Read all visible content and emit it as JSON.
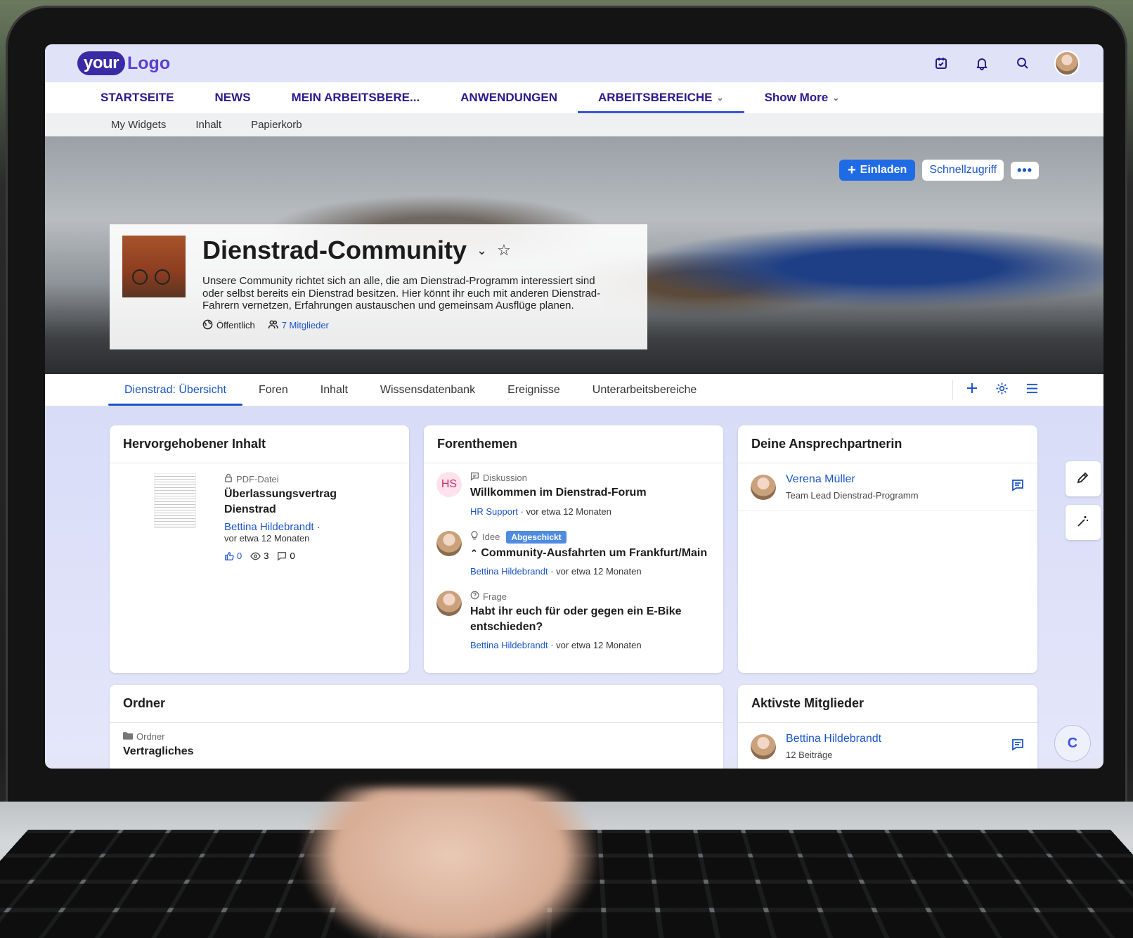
{
  "logo": {
    "part1": "your",
    "part2": "Logo"
  },
  "mainnav": [
    {
      "label": "STARTSEITE"
    },
    {
      "label": "NEWS"
    },
    {
      "label": "MEIN ARBEITSBERE..."
    },
    {
      "label": "ANWENDUNGEN"
    },
    {
      "label": "ARBEITSBEREICHE"
    },
    {
      "label": "Show More"
    }
  ],
  "subnav": [
    "My Widgets",
    "Inhalt",
    "Papierkorb"
  ],
  "hero": {
    "invite": "Einladen",
    "quick": "Schnellzugriff",
    "more": "•••",
    "title": "Dienstrad-Community",
    "description": "Unsere Community richtet sich an alle, die am Dienstrad-Programm interessiert sind oder selbst bereits ein Dienstrad besitzen. Hier könnt ihr euch mit anderen Dienstrad-Fahrern vernetzen, Erfahrungen austauschen und gemeinsam Ausflüge planen.",
    "visibility": "Öffentlich",
    "members": "7 Mitglieder"
  },
  "tabs": [
    "Dienstrad: Übersicht",
    "Foren",
    "Inhalt",
    "Wissensdatenbank",
    "Ereignisse",
    "Unterarbeitsbereiche"
  ],
  "highlight": {
    "header": "Hervorgehobener Inhalt",
    "type": "PDF-Datei",
    "title": "Überlassungsvertrag Dienstrad",
    "author": "Bettina Hildebrandt",
    "author_sep": "·",
    "time": "vor etwa 12 Monaten",
    "likes": "0",
    "views": "3",
    "comments": "0"
  },
  "forum": {
    "header": "Forenthemen",
    "items": [
      {
        "type": "Diskussion",
        "badge": "",
        "title": "Willkommen im Dienstrad-Forum",
        "author": "HR Support",
        "time": "· vor etwa 12 Monaten",
        "initials": "HS"
      },
      {
        "type": "Idee",
        "badge": "Abgeschickt",
        "title": "Community-Ausfahrten um Frankfurt/Main",
        "author": "Bettina Hildebrandt",
        "time": "· vor etwa 12 Monaten",
        "initials": ""
      },
      {
        "type": "Frage",
        "badge": "",
        "title": "Habt ihr euch für oder gegen ein E-Bike entschieden?",
        "author": "Bettina Hildebrandt",
        "time": "· vor etwa 12 Monaten",
        "initials": ""
      }
    ]
  },
  "contact": {
    "header": "Deine Ansprechpartnerin",
    "name": "Verena Müller",
    "role": "Team Lead Dienstrad-Programm"
  },
  "folder": {
    "header": "Ordner",
    "type": "Ordner",
    "name": "Vertragliches"
  },
  "active": {
    "header": "Aktivste Mitglieder",
    "name": "Bettina Hildebrandt",
    "posts": "12 Beiträge"
  },
  "fab": "C"
}
